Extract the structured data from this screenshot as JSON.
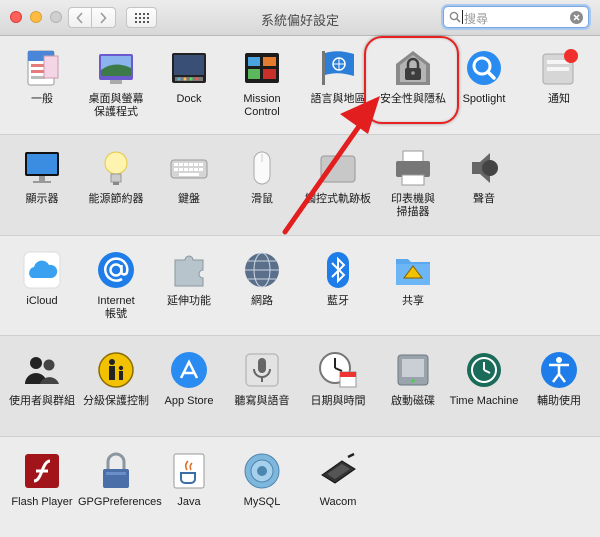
{
  "window": {
    "title": "系統偏好設定"
  },
  "search": {
    "placeholder": "搜尋"
  },
  "rows": [
    [
      {
        "name": "general",
        "label": "一般",
        "icon": "general-icon"
      },
      {
        "name": "desktop-screensaver",
        "label": "桌面與螢幕\n保護程式",
        "icon": "desktop-icon"
      },
      {
        "name": "dock",
        "label": "Dock",
        "icon": "dock-icon"
      },
      {
        "name": "mission-control",
        "label": "Mission\nControl",
        "icon": "mission-control-icon"
      },
      {
        "name": "language-region",
        "label": "語言與地區",
        "icon": "globe-flag-icon"
      },
      {
        "name": "security-privacy",
        "label": "安全性與隱私",
        "icon": "house-lock-icon"
      },
      {
        "name": "spotlight",
        "label": "Spotlight",
        "icon": "magnifier-icon"
      },
      {
        "name": "notifications",
        "label": "通知",
        "icon": "notifications-icon"
      }
    ],
    [
      {
        "name": "displays",
        "label": "顯示器",
        "icon": "monitor-icon"
      },
      {
        "name": "energy-saver",
        "label": "能源節約器",
        "icon": "lightbulb-icon"
      },
      {
        "name": "keyboard",
        "label": "鍵盤",
        "icon": "keyboard-icon"
      },
      {
        "name": "mouse",
        "label": "滑鼠",
        "icon": "mouse-icon"
      },
      {
        "name": "trackpad",
        "label": "觸控式軌跡板",
        "icon": "trackpad-icon"
      },
      {
        "name": "printers-scanners",
        "label": "印表機與\n掃描器",
        "icon": "printer-icon"
      },
      {
        "name": "sound",
        "label": "聲音",
        "icon": "speaker-icon"
      }
    ],
    [
      {
        "name": "icloud",
        "label": "iCloud",
        "icon": "cloud-icon"
      },
      {
        "name": "internet-accounts",
        "label": "Internet\n帳號",
        "icon": "at-icon"
      },
      {
        "name": "extensions",
        "label": "延伸功能",
        "icon": "puzzle-icon"
      },
      {
        "name": "network",
        "label": "網路",
        "icon": "network-globe-icon"
      },
      {
        "name": "bluetooth",
        "label": "藍牙",
        "icon": "bluetooth-icon"
      },
      {
        "name": "sharing",
        "label": "共享",
        "icon": "sharing-folder-icon"
      }
    ],
    [
      {
        "name": "users-groups",
        "label": "使用者與群組",
        "icon": "users-icon"
      },
      {
        "name": "parental-controls",
        "label": "分級保護控制",
        "icon": "parental-icon"
      },
      {
        "name": "app-store",
        "label": "App Store",
        "icon": "app-store-icon"
      },
      {
        "name": "dictation-speech",
        "label": "聽寫與語音",
        "icon": "microphone-icon"
      },
      {
        "name": "date-time",
        "label": "日期與時間",
        "icon": "clock-calendar-icon"
      },
      {
        "name": "startup-disk",
        "label": "啟動磁碟",
        "icon": "disk-icon"
      },
      {
        "name": "time-machine",
        "label": "Time Machine",
        "icon": "time-machine-icon"
      },
      {
        "name": "accessibility",
        "label": "輔助使用",
        "icon": "accessibility-icon"
      }
    ],
    [
      {
        "name": "flash-player",
        "label": "Flash Player",
        "icon": "flash-icon"
      },
      {
        "name": "gpg-preferences",
        "label": "GPGPreferences",
        "icon": "padlock-icon"
      },
      {
        "name": "java",
        "label": "Java",
        "icon": "java-icon"
      },
      {
        "name": "mysql",
        "label": "MySQL",
        "icon": "mysql-icon"
      },
      {
        "name": "wacom",
        "label": "Wacom",
        "icon": "tablet-icon"
      }
    ]
  ]
}
